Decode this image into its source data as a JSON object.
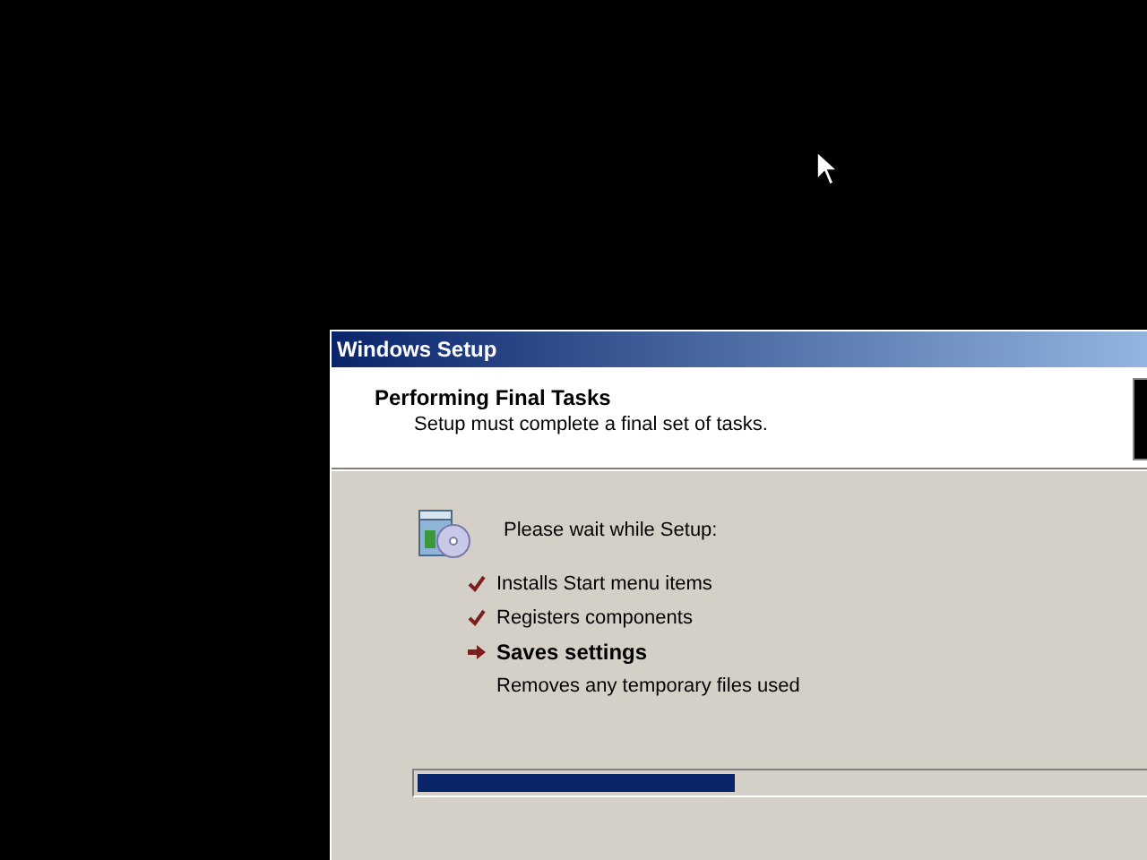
{
  "window": {
    "title": "Windows Setup"
  },
  "header": {
    "title": "Performing Final Tasks",
    "subtitle": "Setup must complete a final set of tasks."
  },
  "intro": "Please wait while Setup:",
  "tasks": [
    {
      "label": "Installs Start menu items",
      "kind": "done"
    },
    {
      "label": "Registers components",
      "kind": "done"
    },
    {
      "label": "Saves settings",
      "kind": "current"
    },
    {
      "label": "Removes any temporary files used",
      "kind": "pending"
    }
  ],
  "progress": {
    "level": 0.39
  }
}
